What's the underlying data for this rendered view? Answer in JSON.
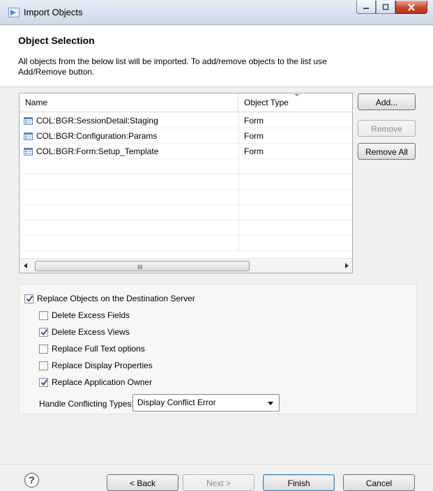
{
  "window": {
    "title": "Import Objects",
    "buttons": {
      "minimize": "minimize-icon",
      "maximize": "maximize-icon",
      "close": "close-icon"
    }
  },
  "header": {
    "heading": "Object Selection",
    "description": "All objects from the below list will be imported. To add/remove objects to the list use Add/Remove button."
  },
  "table": {
    "columns": [
      "Name",
      "Object Type"
    ],
    "rows": [
      {
        "name": "COL:BGR:SessionDetail:Staging",
        "type": "Form"
      },
      {
        "name": "COL:BGR:Configuration:Params",
        "type": "Form"
      },
      {
        "name": "COL:BGR:Form:Setup_Template",
        "type": "Form"
      }
    ],
    "scroll_grip": "III"
  },
  "side_buttons": {
    "add": "Add...",
    "remove": "Remove",
    "remove_all": "Remove All"
  },
  "options": {
    "replace": {
      "label": "Replace Objects on the Destination Server",
      "checked": true
    },
    "items": [
      {
        "label": "Delete Excess Fields",
        "checked": false
      },
      {
        "label": "Delete Excess Views",
        "checked": true
      },
      {
        "label": "Replace Full Text options",
        "checked": false
      },
      {
        "label": "Replace Display Properties",
        "checked": false
      },
      {
        "label": "Replace Application Owner",
        "checked": true
      }
    ],
    "conflict_label": "Handle Conflicting Types:",
    "conflict_value": "Display Conflict Error"
  },
  "footer": {
    "back": "< Back",
    "next": "Next >",
    "finish": "Finish",
    "cancel": "Cancel",
    "help": "?"
  },
  "colors": {
    "title_bar": "#d6e0ee",
    "close_button": "#c9462c",
    "primary_border": "#3c7fb1"
  }
}
